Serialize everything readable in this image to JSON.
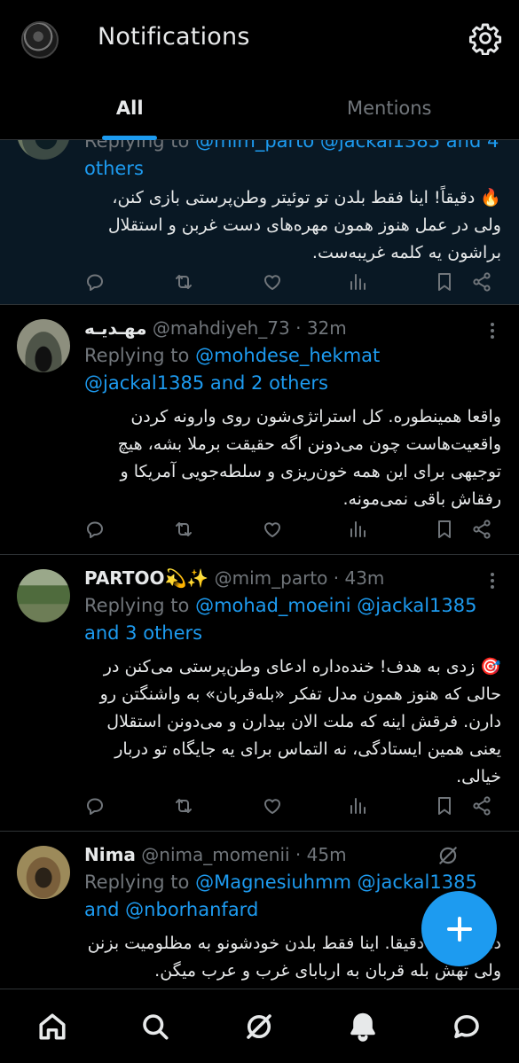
{
  "header": {
    "title": "Notifications",
    "tabs": [
      {
        "label": "All",
        "active": true
      },
      {
        "label": "Mentions",
        "active": false
      }
    ]
  },
  "posts": [
    {
      "replying_prefix": "Replying to",
      "replying_to": "@mim_parto @jackal1385 and 4 others",
      "text": "🔥 دقیقاً! اینا فقط بلدن تو توئیتر وطن‌پرستی بازی کنن، ولی در عمل هنوز همون مهره‌های دست غربن و استقلال براشون یه کلمه غریبه‌ست."
    },
    {
      "name": "مهـدیـه",
      "handle": "@mahdiyeh_73",
      "time": "· 32m",
      "replying_prefix": "Replying to",
      "replying_to": "@mohdese_hekmat @jackal1385 and 2 others",
      "text": "واقعا همینطوره. کل استراتژی‌شون روی وارونه کردن واقعیت‌هاست چون می‌دونن اگه حقیقت برملا بشه، هیچ توجیهی برای این همه خون‌ریزی و سلطه‌جویی آمریکا و رفقاش باقی نمی‌مونه."
    },
    {
      "name": "PARTOO💫✨",
      "handle": "@mim_parto",
      "time": "· 43m",
      "replying_prefix": "Replying to",
      "replying_to": "@mohad_moeini @jackal1385 and 3 others",
      "text": "🎯 زدی به هدف! خنده‌داره ادعای وطن‌پرستی می‌کنن در حالی که هنوز همون مدل تفکر «بله‌قربان» به واشنگتن رو دارن. فرقش اینه که ملت الان بیدارن و می‌دونن استقلال یعنی همین ایستادگی، نه التماس برای یه جایگاه تو دربار خیالی."
    },
    {
      "name": "Nima",
      "handle": "@nima_momenii",
      "time": "· 45m",
      "replying_prefix": "Replying to",
      "replying_to": "@Magnesiuhmm @jackal1385 and @nborhanfard",
      "text": "دمت گرم، دقیقا. اینا فقط بلدن خودشونو به مظلومیت بزنن ولی تهش بله قربان به اربابای غرب و عرب میگن."
    }
  ],
  "icons": {
    "settings": "gear-icon",
    "reply": "reply-icon",
    "retweet": "retweet-icon",
    "like": "heart-icon",
    "views": "views-icon",
    "bookmark": "bookmark-icon",
    "share": "share-icon",
    "compose": "plus-icon",
    "grok": "grok-icon"
  },
  "bottom_nav": [
    "home-icon",
    "search-icon",
    "grok-icon",
    "notifications-icon",
    "messages-icon"
  ],
  "colors": {
    "accent": "#1d9bf0",
    "muted": "#71767b",
    "text": "#e7e9ea",
    "highlight_bg": "#091824"
  }
}
